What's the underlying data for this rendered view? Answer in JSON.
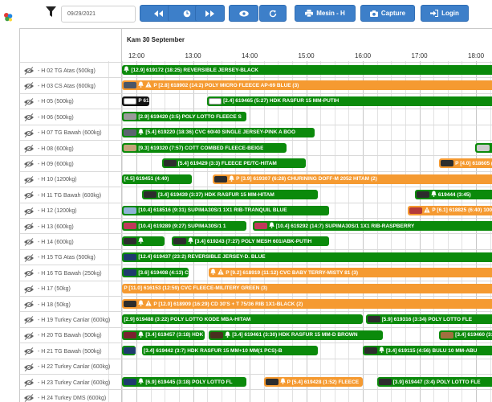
{
  "toolbar": {
    "date_value": "09/29/2021",
    "buttons": [
      {
        "name": "prev-button",
        "icon": "fast-backward-icon",
        "label": ""
      },
      {
        "name": "now-button",
        "icon": "clock-icon",
        "label": ""
      },
      {
        "name": "next-button",
        "icon": "fast-forward-icon",
        "label": ""
      },
      {
        "name": "view-button",
        "icon": "eye-icon",
        "label": ""
      },
      {
        "name": "refresh-button",
        "icon": "refresh-icon",
        "label": ""
      },
      {
        "name": "printer-button",
        "icon": "printer-icon",
        "label": "Mesin - H"
      },
      {
        "name": "capture-button",
        "icon": "camera-icon",
        "label": "Capture"
      },
      {
        "name": "login-button",
        "icon": "login-icon",
        "label": "Login"
      }
    ]
  },
  "schedule": {
    "date_header": "Kam 30 September",
    "hours": [
      "12:00",
      "13:00",
      "14:00",
      "15:00",
      "16:00",
      "17:00",
      "18:00"
    ],
    "rows": [
      {
        "label": "- H 02 TG Atas (500kg)",
        "bars": [
          {
            "color": "green",
            "start": 11.75,
            "end": 18.8,
            "swatch": "",
            "bell": true,
            "text": "[12.9] 619172 (18:25) REVERSIBLE JERSEY-BLACK"
          }
        ]
      },
      {
        "label": "- H 03 CS Atas (600kg)",
        "bars": [
          {
            "color": "orange",
            "start": 11.75,
            "end": 18.8,
            "swatch": "#4a5668",
            "bell": true,
            "warn": true,
            "text": "P [2.8] 618902 (14:2) POLY MICRO FLEECE AP-69 BLUE (3)"
          }
        ]
      },
      {
        "label": "- H 05 (500kg)",
        "bars": [
          {
            "color": "black",
            "start": 11.75,
            "end": 12.22,
            "swatch": "#ffffff",
            "text": "P 61"
          },
          {
            "color": "green",
            "start": 13.25,
            "end": 18.8,
            "swatch": "#ffffff",
            "text": "[2.4] 619465 (5:27) HDK RASFUR 15 MM-PUTIH"
          }
        ]
      },
      {
        "label": "- H 06 (500kg)",
        "bars": [
          {
            "color": "green",
            "start": 11.75,
            "end": 13.95,
            "swatch": "#9a9a9a",
            "text": "[2.9] 619420 (3:5) POLY LOTTO FLEECE S"
          }
        ]
      },
      {
        "label": "- H 07 TG Bawah (600kg)",
        "bars": [
          {
            "color": "green",
            "start": 11.75,
            "end": 15.15,
            "swatch": "#5c6370",
            "bell": true,
            "text": "[5.4] 619220 (18:36) CVC 60/40 SINGLE JERSEY-PINK A BOO"
          }
        ]
      },
      {
        "label": "- H 08 (600kg)",
        "bars": [
          {
            "color": "green",
            "start": 11.75,
            "end": 14.65,
            "swatch": "#c4a37a",
            "text": "[9.3] 619320 (7:57) COTT COMBED FLEECE-BEIGE"
          },
          {
            "color": "green",
            "start": 17.98,
            "end": 18.8,
            "swatch": "#cccccc",
            "text": ""
          }
        ]
      },
      {
        "label": "- H 09 (600kg)",
        "bars": [
          {
            "color": "green",
            "start": 12.45,
            "end": 15.0,
            "swatch": "#2d2d2d",
            "text": "[5.4] 619429 (3:3) FLEECE PE/TC-HITAM"
          },
          {
            "color": "orange",
            "start": 17.35,
            "end": 18.8,
            "swatch": "#2d2d2d",
            "text": "P [4.0] 618605 (3"
          }
        ]
      },
      {
        "label": "- H 10 (1200kg)",
        "bars": [
          {
            "color": "green",
            "start": 11.75,
            "end": 12.98,
            "swatch": "",
            "text": "[4.5] 619451 (4:40)"
          },
          {
            "color": "orange",
            "start": 13.35,
            "end": 18.8,
            "swatch": "#2d2d2d",
            "bell": true,
            "text": "P [3.9] 619307 (6:28) CHURINING DOFF-M 2052 HITAM (2)"
          }
        ]
      },
      {
        "label": "- H 11 TG Bawah (600kg)",
        "bars": [
          {
            "color": "green",
            "start": 12.1,
            "end": 15.2,
            "swatch": "#2d2d2d",
            "text": "[3.4] 619439 (3:37) HDK RASFUR 15 MM-HITAM"
          },
          {
            "color": "green",
            "start": 16.92,
            "end": 18.8,
            "swatch": "#2d2d2d",
            "bell": true,
            "text": "619444 (3:45)"
          }
        ]
      },
      {
        "label": "- H 12 (1200kg)",
        "bars": [
          {
            "color": "green",
            "start": 11.75,
            "end": 15.4,
            "swatch": "#8fb3d6",
            "text": "[10.4] 618516 (9:31) SUPIMA30S/1 1X1 RIB-TRANQUIL BLUE"
          },
          {
            "color": "orange",
            "start": 16.8,
            "end": 18.8,
            "swatch": "#b33a3a",
            "warn": true,
            "text": "P [6.1] 618825 (6:40) 100%"
          }
        ]
      },
      {
        "label": "- H 13 (600kg)",
        "bars": [
          {
            "color": "green",
            "start": 11.75,
            "end": 13.95,
            "swatch": "#c0395a",
            "text": "[10.4] 619289 (9:27) SUPIMA30S/1 1"
          },
          {
            "color": "green",
            "start": 14.05,
            "end": 18.8,
            "swatch": "#c0395a",
            "bell": true,
            "text": "[10.4] 619292 (14:7) SUPIMA30S/1 1X1 RIB-RASPBERRY"
          }
        ]
      },
      {
        "label": "- H 14 (600kg)",
        "bars": [
          {
            "color": "green",
            "start": 11.75,
            "end": 12.5,
            "swatch": "#2d2d2d",
            "bell": true,
            "text": ""
          },
          {
            "color": "green",
            "start": 12.62,
            "end": 15.4,
            "swatch": "#2d2d2d",
            "bell": true,
            "text": "[3.4] 619243 (7:27) POLY MESH 601/ABK-PUTIH"
          }
        ]
      },
      {
        "label": "- H 15 TG Atas (500kg)",
        "bars": [
          {
            "color": "green",
            "start": 11.75,
            "end": 18.8,
            "swatch": "#1f3a6e",
            "text": "[12.4] 619437 (23:2) REVERSIBLE JERSEY-D. BLUE"
          }
        ]
      },
      {
        "label": "- H 16 TG Bawah (250kg)",
        "bars": [
          {
            "color": "green",
            "start": 11.75,
            "end": 12.92,
            "swatch": "#1f3a6e",
            "text": "[3.6] 619408 (4:13) C"
          },
          {
            "color": "orange",
            "start": 13.28,
            "end": 18.8,
            "swatch": "",
            "bell": true,
            "warn": true,
            "text": "P [9.2] 618919 (11:12) CVC BABY TERRY-MISTY 81 (3)"
          }
        ]
      },
      {
        "label": "- H 17 (50kg)",
        "bars": [
          {
            "color": "orange",
            "start": 11.75,
            "end": 18.8,
            "swatch": "",
            "text": "P [11.0] 616153 (12:59) CVC FLEECE-MILITERY GREEN (3)"
          }
        ]
      },
      {
        "label": "- H 18 (50kg)",
        "bars": [
          {
            "color": "orange",
            "start": 11.75,
            "end": 18.8,
            "swatch": "#2d2d2d",
            "bell": true,
            "warn": true,
            "text": "P [12.0] 618909 (16:29) CD 30'S + T 75/36 RIB 1X1-BLACK (2)"
          }
        ]
      },
      {
        "label": "- H 19 Turkey Canlar (600kg)",
        "bars": [
          {
            "color": "green",
            "start": 11.75,
            "end": 16.0,
            "swatch": "",
            "text": "[2.9] 619488 (3:22) POLY LOTTO KODE MBA-HITAM"
          },
          {
            "color": "green",
            "start": 16.05,
            "end": 18.8,
            "swatch": "#2d2d2d",
            "text": "[5.9] 619316 (3:34) POLY LOTTO FLE"
          }
        ]
      },
      {
        "label": "- H 20 TG Bawah (500kg)",
        "bars": [
          {
            "color": "green",
            "start": 11.75,
            "end": 13.2,
            "swatch": "#7a2230",
            "bell": true,
            "text": "[3.4] 619457 (3:18) HDK"
          },
          {
            "color": "green",
            "start": 13.28,
            "end": 16.35,
            "swatch": "#4a3020",
            "bell": true,
            "text": "[3.4] 619461 (3:30) HDK RASFUR 15 MM-D BROWN"
          },
          {
            "color": "green",
            "start": 17.35,
            "end": 18.8,
            "swatch": "#a07040",
            "text": "[3.4] 619460 (3:"
          }
        ]
      },
      {
        "label": "- H 21 TG Bawah (500kg)",
        "bars": [
          {
            "color": "green",
            "start": 11.75,
            "end": 11.98,
            "swatch": "#1f3a6e",
            "text": ""
          },
          {
            "color": "green",
            "start": 12.1,
            "end": 15.2,
            "swatch": "",
            "text": "[3.4] 619442 (3:7) HDK RASFUR 15 MM+10 MM(1 PCS)-B"
          },
          {
            "color": "green",
            "start": 16.0,
            "end": 18.8,
            "swatch": "#2d2d2d",
            "bell": true,
            "text": "[3.4] 619115 (4:56) BULU 10 MM-ABU"
          }
        ]
      },
      {
        "label": "- H 22 Turkey Canlar (600kg)",
        "bars": []
      },
      {
        "label": "- H 23 Turkey Canlar (600kg)",
        "bars": [
          {
            "color": "green",
            "start": 11.75,
            "end": 13.95,
            "swatch": "#1f3a6e",
            "bell": true,
            "text": "[6.9] 619445 (3:18) POLY LOTTO FL"
          },
          {
            "color": "orange",
            "start": 14.25,
            "end": 16.0,
            "swatch": "#2d2d2d",
            "bell": true,
            "text": "P [5.4] 619428 (1:52) FLEECE"
          },
          {
            "color": "green",
            "start": 16.25,
            "end": 18.8,
            "swatch": "#2d2d2d",
            "text": "[3.9] 619447 (3:4) POLY LOTTO FLE"
          }
        ]
      },
      {
        "label": "- H 24 Turkey DMS (600kg)",
        "bars": []
      }
    ]
  }
}
